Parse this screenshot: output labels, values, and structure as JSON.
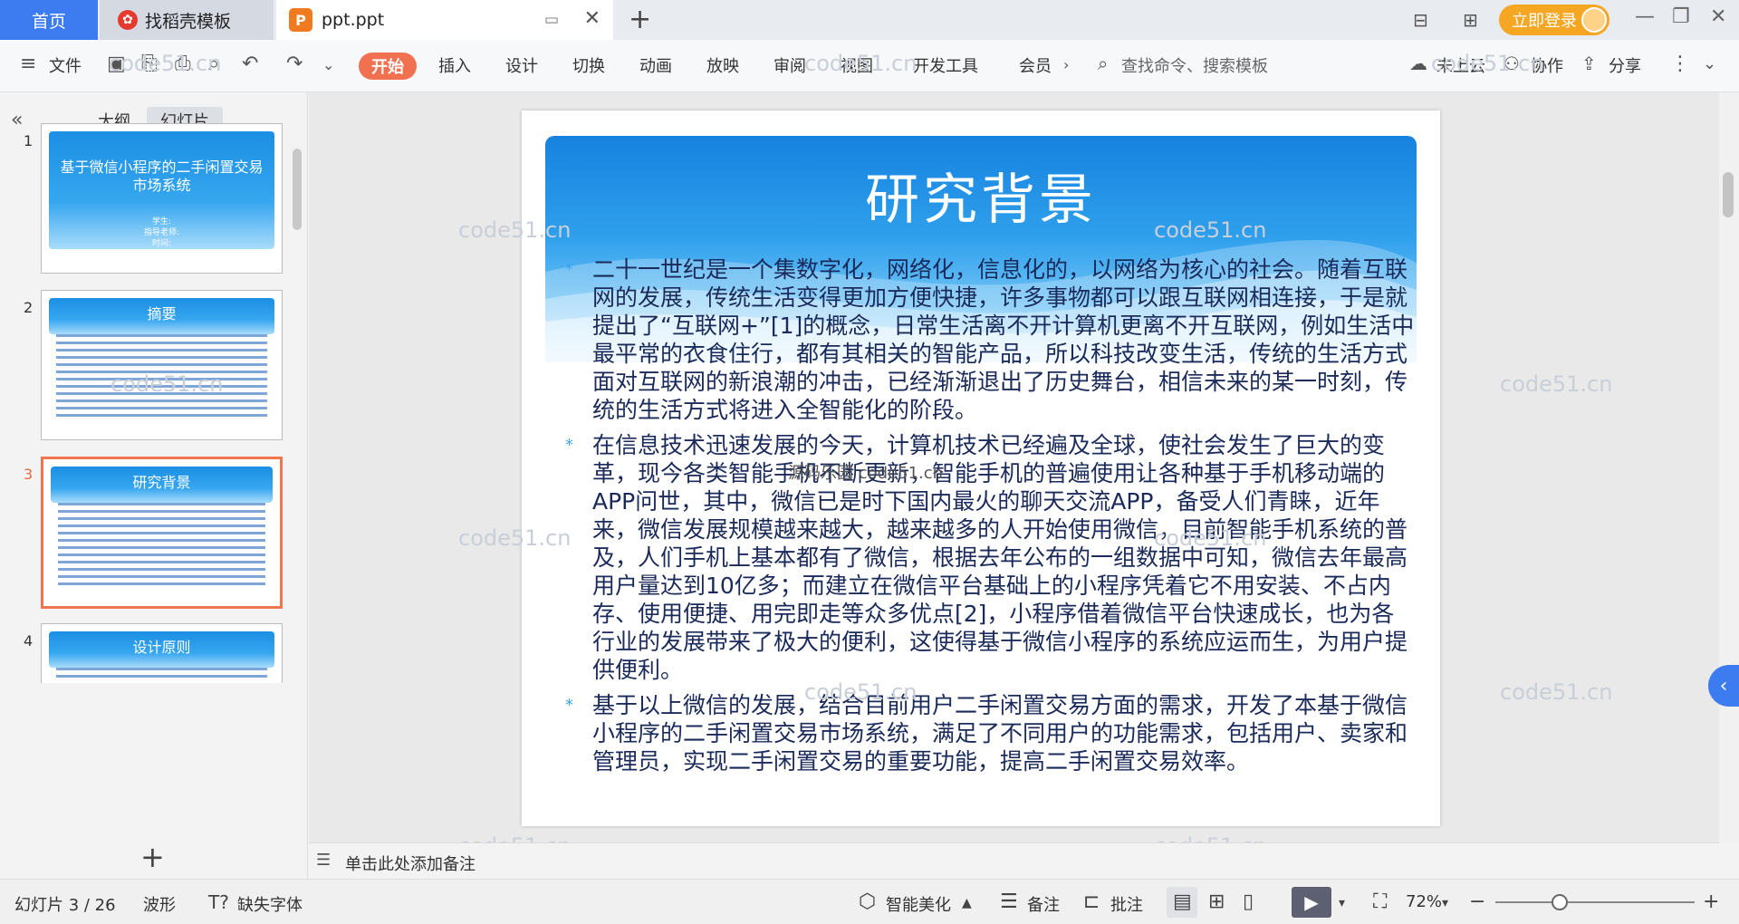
{
  "titlebar": {
    "home_tab": "首页",
    "template_tab": "找稻壳模板",
    "doc_tab": "ppt.ppt",
    "doc_icon_letter": "P",
    "login": "立即登录"
  },
  "ribbon": {
    "file": "文件",
    "tabs": [
      "开始",
      "插入",
      "设计",
      "切换",
      "动画",
      "放映",
      "审阅",
      "视图",
      "开发工具",
      "会员"
    ],
    "search_placeholder": "查找命令、搜索模板",
    "cloud": "未上云",
    "collab": "协作",
    "share": "分享"
  },
  "leftpanel": {
    "tab_outline": "大纲",
    "tab_slides": "幻灯片",
    "slides": [
      {
        "num": "1",
        "title": "基于微信小程序的二手闲置交易市场系统",
        "meta": [
          "学生:",
          "指导老师:",
          "时间:"
        ]
      },
      {
        "num": "2",
        "title": "摘要"
      },
      {
        "num": "3",
        "title": "研究背景"
      },
      {
        "num": "4",
        "title": "设计原则"
      }
    ]
  },
  "slide": {
    "title": "研究背景",
    "bullets": [
      "二十一世纪是一个集数字化，网络化，信息化的，以网络为核心的社会。随着互联网的发展，传统生活变得更加方便快捷，许多事物都可以跟互联网相连接，于是就提出了“互联网+”[1]的概念，日常生活离不开计算机更离不开互联网，例如生活中最平常的衣食住行，都有其相关的智能产品，所以科技改变生活，传统的生活方式面对互联网的新浪潮的冲击，已经渐渐退出了历史舞台，相信未来的某一时刻，传统的生活方式将进入全智能化的阶段。",
      "在信息技术迅速发展的今天，计算机技术已经遍及全球，使社会发生了巨大的变革，现今各类智能手机不断更新，智能手机的普遍使用让各种基于手机移动端的APP问世，其中，微信已是时下国内最火的聊天交流APP，备受人们青睐，近年来，微信发展规模越来越大，越来越多的人开始使用微信，目前智能手机系统的普及，人们手机上基本都有了微信，根据去年公布的一组数据中可知，微信去年最高用户量达到10亿多；而建立在微信平台基础上的小程序凭着它不用安装、不占内存、使用便捷、用完即走等众多优点[2]，小程序借着微信平台快速成长，也为各行业的发展带来了极大的便利，这使得基于微信小程序的系统应运而生，为用户提供便利。",
      "基于以上微信的发展，结合目前用户二手闲置交易方面的需求，开发了本基于微信小程序的二手闲置交易市场系统，满足了不同用户的功能需求，包括用户、卖家和管理员，实现二手闲置交易的重要功能，提高二手闲置交易效率。"
    ],
    "bullet_marker": "*"
  },
  "watermark": {
    "text": "code51.cn",
    "center_text": "源码乐园 code51.cn"
  },
  "notes": {
    "placeholder": "单击此处添加备注"
  },
  "statusbar": {
    "slide_counter": "幻灯片 3 / 26",
    "theme": "波形",
    "missing_font": "缺失字体",
    "beautify": "智能美化",
    "notes_btn": "备注",
    "comment_btn": "批注",
    "zoom": "72%"
  },
  "colors": {
    "accent_blue": "#3d7cf0",
    "start_tab": "#f07050",
    "login": "#f5a623",
    "slide_text": "#1a2a5a"
  }
}
